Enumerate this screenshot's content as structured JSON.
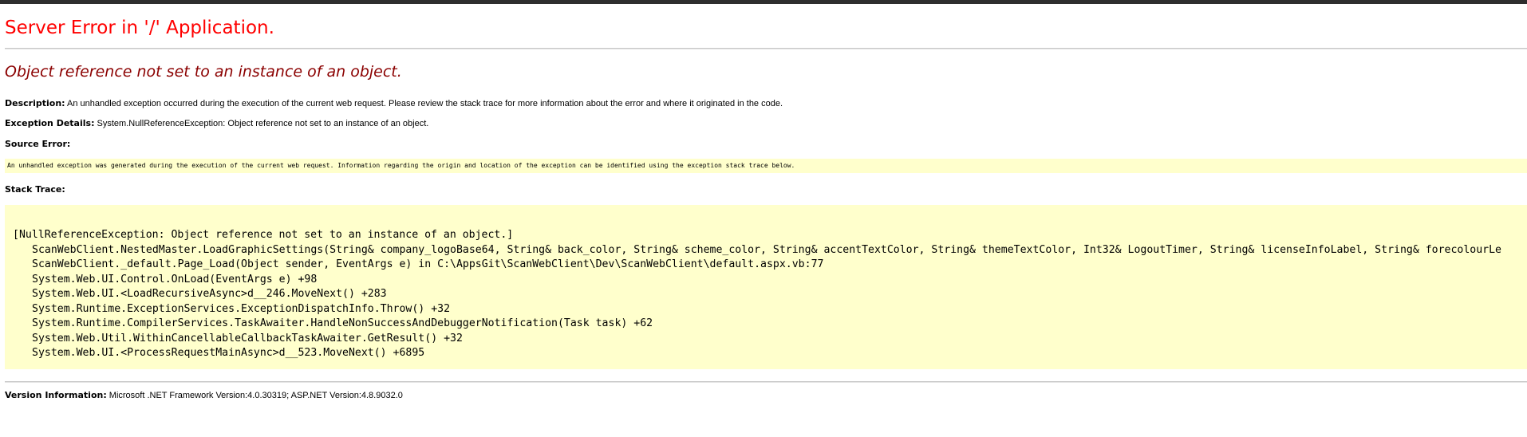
{
  "page": {
    "title": "Server Error in '/' Application.",
    "error_heading": "Object reference not set to an instance of an object.",
    "description": {
      "label": "Description:",
      "text": " An unhandled exception occurred during the execution of the current web request. Please review the stack trace for more information about the error and where it originated in the code."
    },
    "exception_details": {
      "label": "Exception Details:",
      "text": " System.NullReferenceException: Object reference not set to an instance of an object."
    },
    "source_error": {
      "label": "Source Error:",
      "text": "An unhandled exception was generated during the execution of the current web request. Information regarding the origin and location of the exception can be identified using the exception stack trace below."
    },
    "stack_trace": {
      "label": "Stack Trace:",
      "lines": [
        "[NullReferenceException: Object reference not set to an instance of an object.]",
        "ScanWebClient.NestedMaster.LoadGraphicSettings(String& company_logoBase64, String& back_color, String& scheme_color, String& accentTextColor, String& themeTextColor, Int32& LogoutTimer, String& licenseInfoLabel, String& forecolourLe",
        "ScanWebClient._default.Page_Load(Object sender, EventArgs e) in C:\\AppsGit\\ScanWebClient\\Dev\\ScanWebClient\\default.aspx.vb:77",
        "System.Web.UI.Control.OnLoad(EventArgs e) +98",
        "System.Web.UI.<LoadRecursiveAsync>d__246.MoveNext() +283",
        "System.Runtime.ExceptionServices.ExceptionDispatchInfo.Throw() +32",
        "System.Runtime.CompilerServices.TaskAwaiter.HandleNonSuccessAndDebuggerNotification(Task task) +62",
        "System.Web.Util.WithinCancellableCallbackTaskAwaiter.GetResult() +32",
        "System.Web.UI.<ProcessRequestMainAsync>d__523.MoveNext() +6895"
      ]
    },
    "version_information": {
      "label": "Version Information:",
      "text": " Microsoft .NET Framework Version:4.0.30319; ASP.NET Version:4.8.9032.0"
    }
  },
  "colors": {
    "title": "#ff0000",
    "error_heading": "#8b0000",
    "code_background": "#ffffcc",
    "top_bar": "#2e2e2e"
  }
}
